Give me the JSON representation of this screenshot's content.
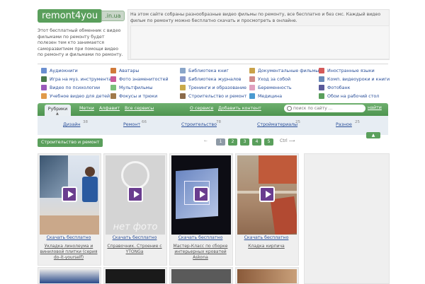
{
  "header": {
    "logo_main": "remont4you",
    "logo_tld": ".in.ua",
    "description": "Этот бесплатный обменник с видео фильмами по ремонту будет полезен тем кто занимается саморазвитием при помощи видео по ремонту и фильмами по ремонту.",
    "top_text": "На этом сайте собраны разнообразные видео фильмы по ремонту, все бесплатно и без смс. Каждый видео фильм по ремонту можно бесплатно скачать и просмотреть в онлайне."
  },
  "categories": [
    {
      "label": "Аудиокниги",
      "color": "#6b8fd0"
    },
    {
      "label": "Аватары",
      "color": "#d07a3a"
    },
    {
      "label": "Библиотека книг",
      "color": "#8aa6c9"
    },
    {
      "label": "Документальные фильмы",
      "color": "#c9a24a"
    },
    {
      "label": "Иностранные языки",
      "color": "#d45a5a"
    },
    {
      "label": "Игра на муз. инструментах",
      "color": "#4a7a4a"
    },
    {
      "label": "Фото знаменитостей",
      "color": "#c95a9a"
    },
    {
      "label": "Библиотека журналов",
      "color": "#8a9acb"
    },
    {
      "label": "Уход за собой",
      "color": "#d08a8a"
    },
    {
      "label": "Комп. видеоуроки и книги",
      "color": "#6a8aba"
    },
    {
      "label": "Видео по психологии",
      "color": "#9a5aba"
    },
    {
      "label": "Мультфильмы",
      "color": "#7ac07a"
    },
    {
      "label": "Тренинги и образование",
      "color": "#caaa4a"
    },
    {
      "label": "Беременность",
      "color": "#e0a0c0"
    },
    {
      "label": "Фотобанк",
      "color": "#5a5a9a"
    },
    {
      "label": "Учебное видео для детей",
      "color": "#e09a4a"
    },
    {
      "label": "Фокусы и трюки",
      "color": "#a07a4a"
    },
    {
      "label": "Строительство и ремонт",
      "color": "#8a6a4a"
    },
    {
      "label": "Медицина",
      "color": "#4a9ad0"
    },
    {
      "label": "Обои на рабочий стол",
      "color": "#5a9f5c"
    }
  ],
  "nav": {
    "active_tab": "Рубрики",
    "links": [
      "Метки",
      "Алфавит",
      "Все сервисы",
      "О сервисе",
      "Добавить контент"
    ],
    "search_placeholder": "поиск по сайту ...",
    "search_button": "найти"
  },
  "submenu": [
    {
      "label": "Дизайн",
      "count": "38"
    },
    {
      "label": "Ремонт",
      "count": "66"
    },
    {
      "label": "Строительство",
      "count": "78"
    },
    {
      "label": "Стройматериалы",
      "count": "25"
    },
    {
      "label": "Разное",
      "count": "25"
    }
  ],
  "breadcrumb": "Строительство и ремонт",
  "pager": {
    "pages": [
      "1",
      "2",
      "3",
      "4",
      "5"
    ],
    "ctrl_label": "Ctrl"
  },
  "videos": [
    {
      "download": "Скачать бесплатно",
      "title": "Укладка линолеума и виниловой плитки (серия do-it-yourself)"
    },
    {
      "download": "Скачать бесплатно",
      "title": "Справочник. Строение с YTONGа",
      "no_photo": "нет фото"
    },
    {
      "download": "Скачать бесплатно",
      "title": "Мастер-Класс по сборке интерьерных кроватей Askona"
    },
    {
      "download": "Скачать бесплатно",
      "title": "Кладка кирпича"
    }
  ]
}
